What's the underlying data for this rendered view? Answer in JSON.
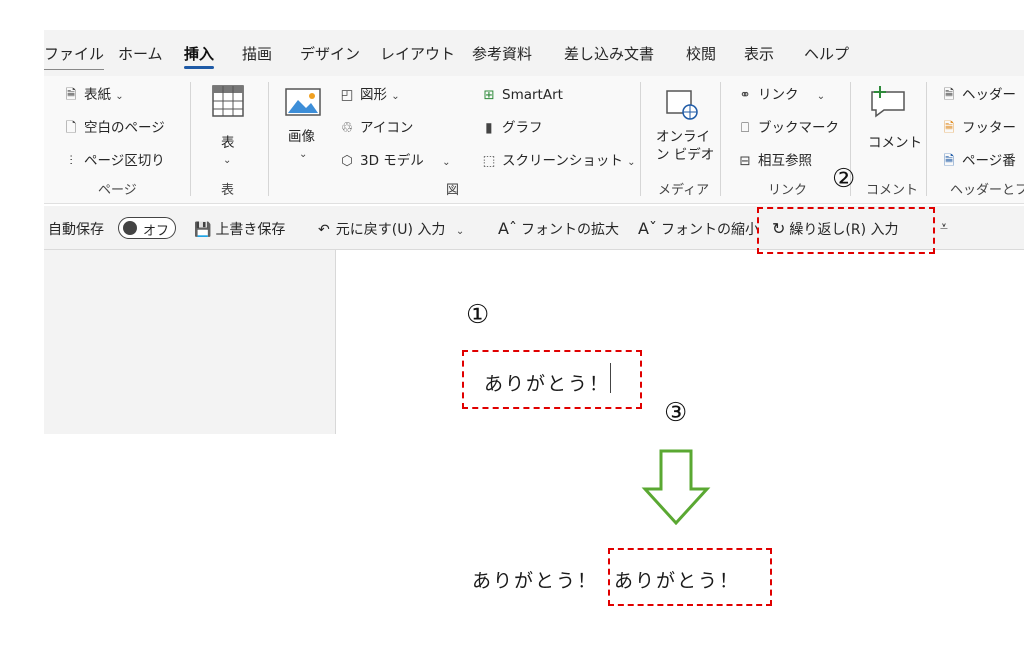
{
  "menu_tabs": [
    "ファイル",
    "ホーム",
    "挿入",
    "描画",
    "デザイン",
    "レイアウト",
    "参考資料",
    "差し込み文書",
    "校閲",
    "表示",
    "ヘルプ"
  ],
  "active_tab": "挿入",
  "ribbon": {
    "page": {
      "cover": "表紙",
      "blank": "空白のページ",
      "break": "ページ区切り",
      "group": "ページ"
    },
    "table": {
      "label": "表",
      "group": "表"
    },
    "illustrations": {
      "image": "画像",
      "shapes": "図形",
      "icons": "アイコン",
      "model3d": "3D モデル",
      "smartart": "SmartArt",
      "chart": "グラフ",
      "screenshot": "スクリーンショット",
      "group": "図"
    },
    "media": {
      "online_video_1": "オンライ",
      "online_video_2": "ン ビデオ",
      "group": "メディア"
    },
    "links": {
      "link": "リンク",
      "bookmark": "ブックマーク",
      "crossref": "相互参照",
      "group": "リンク"
    },
    "comments": {
      "comment": "コメント",
      "group": "コメント"
    },
    "header_footer": {
      "header": "ヘッダー",
      "footer": "フッター",
      "page_number": "ページ番",
      "group": "ヘッダーとフッ"
    }
  },
  "qat": {
    "autosave": "自動保存",
    "autosave_state": "オフ",
    "save": "上書き保存",
    "undo": "元に戻す(U) 入力",
    "grow_font": "フォントの拡大",
    "shrink_font": "フォントの縮小",
    "repeat": "繰り返し(R) 入力"
  },
  "annotations": {
    "one": "①",
    "two": "②",
    "three": "③"
  },
  "document": {
    "line1": "ありがとう！",
    "line2_first": "ありがとう！",
    "line2_repeat": "ありがとう！"
  },
  "colors": {
    "accent": "#1e5aa6",
    "annotation_red": "#e00000",
    "arrow_green": "#5aa832"
  }
}
